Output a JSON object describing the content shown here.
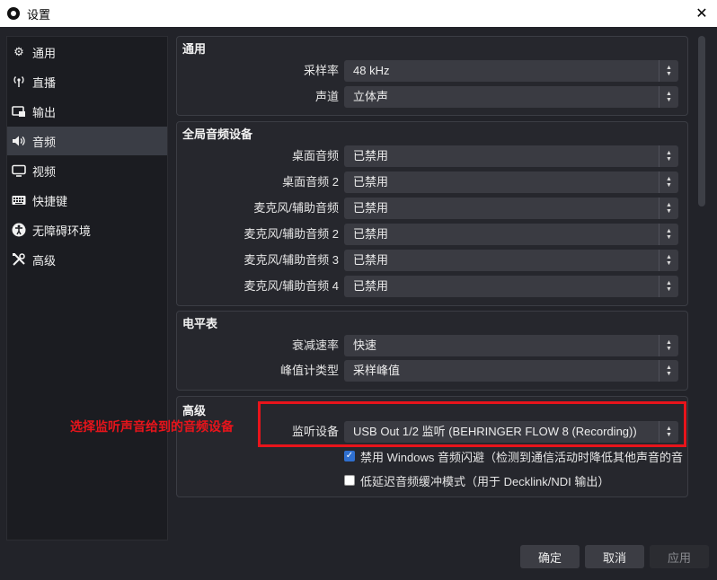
{
  "window": {
    "title": "设置",
    "close_glyph": "✕"
  },
  "sidebar": {
    "items": [
      {
        "label": "通用",
        "icon": "gear-icon",
        "glyph": "⚙"
      },
      {
        "label": "直播",
        "icon": "broadcast-icon",
        "glyph": "📡"
      },
      {
        "label": "输出",
        "icon": "output-icon",
        "glyph": "⎚"
      },
      {
        "label": "音频",
        "icon": "speaker-icon",
        "glyph": "🔊"
      },
      {
        "label": "视频",
        "icon": "monitor-icon",
        "glyph": "▭"
      },
      {
        "label": "快捷键",
        "icon": "keyboard-icon",
        "glyph": "⌨"
      },
      {
        "label": "无障碍环境",
        "icon": "accessibility-icon",
        "glyph": "♿"
      },
      {
        "label": "高级",
        "icon": "tools-icon",
        "glyph": "✂"
      }
    ],
    "active_index": 3
  },
  "groups": {
    "general": {
      "title": "通用",
      "rows": [
        {
          "label": "采样率",
          "value": "48 kHz"
        },
        {
          "label": "声道",
          "value": "立体声"
        }
      ]
    },
    "global_audio": {
      "title": "全局音频设备",
      "rows": [
        {
          "label": "桌面音频",
          "value": "已禁用"
        },
        {
          "label": "桌面音频 2",
          "value": "已禁用"
        },
        {
          "label": "麦克风/辅助音频",
          "value": "已禁用"
        },
        {
          "label": "麦克风/辅助音频 2",
          "value": "已禁用"
        },
        {
          "label": "麦克风/辅助音频 3",
          "value": "已禁用"
        },
        {
          "label": "麦克风/辅助音频 4",
          "value": "已禁用"
        }
      ]
    },
    "meters": {
      "title": "电平表",
      "rows": [
        {
          "label": "衰减速率",
          "value": "快速"
        },
        {
          "label": "峰值计类型",
          "value": "采样峰值"
        }
      ]
    },
    "advanced": {
      "title": "高级",
      "monitor": {
        "label": "监听设备",
        "value": "USB Out 1/2 监听 (BEHRINGER FLOW 8 (Recording))"
      },
      "ducking": {
        "label": "禁用 Windows 音频闪避（检测到通信活动时降低其他声音的音",
        "checked": true
      },
      "low_latency": {
        "label": "低延迟音频缓冲模式（用于 Decklink/NDI 输出）",
        "checked": false
      }
    }
  },
  "annotation": {
    "text": "选择监听声音给到的音频设备"
  },
  "buttons": {
    "ok": "确定",
    "cancel": "取消",
    "apply": "应用"
  },
  "colors": {
    "accent_annotation": "#e8141b",
    "background": "#222329",
    "checkbox_on": "#2f6fcf"
  }
}
